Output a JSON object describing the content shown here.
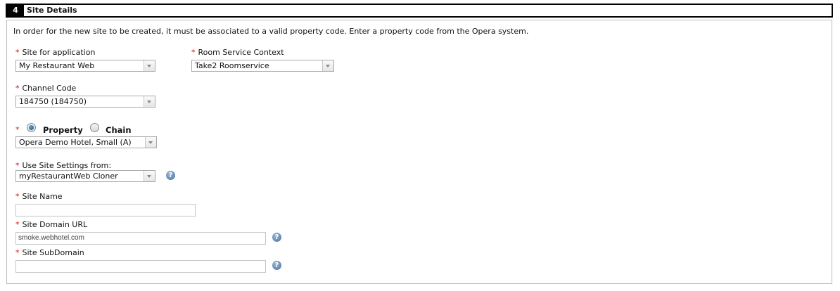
{
  "section": {
    "number": "4",
    "title": "Site Details"
  },
  "intro": "In order for the new site to be created, it must be associated to a valid property code. Enter a property code from the Opera system.",
  "required_mark": "*",
  "site_for_application": {
    "label": "Site for application",
    "value": "My Restaurant Web"
  },
  "room_service_context": {
    "label": "Room Service Context",
    "value": "Take2 Roomservice"
  },
  "channel_code": {
    "label": "Channel Code",
    "value": "184750 (184750)"
  },
  "scope": {
    "property_label": "Property",
    "chain_label": "Chain",
    "selected": "Property",
    "value": "Opera Demo Hotel, Small (A)"
  },
  "use_site_settings": {
    "label": "Use Site Settings from:",
    "value": "myRestaurantWeb Cloner",
    "help": "?"
  },
  "site_name": {
    "label": "Site Name",
    "value": ""
  },
  "site_domain_url": {
    "label": "Site Domain URL",
    "value": "smoke.webhotel.com",
    "help": "?"
  },
  "site_subdomain": {
    "label": "Site SubDomain",
    "value": "",
    "help": "?"
  }
}
